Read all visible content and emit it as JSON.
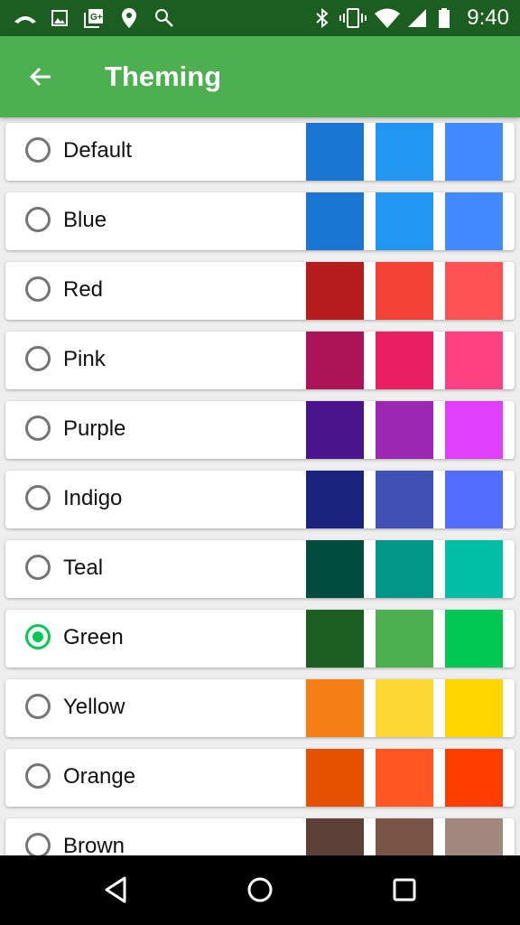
{
  "status_bar": {
    "time": "9:40",
    "left_icons": [
      "missed-call-icon",
      "image-icon",
      "google-plus-icon",
      "location-icon",
      "search-icon"
    ],
    "right_icons": [
      "bluetooth-icon",
      "vibrate-icon",
      "wifi-icon",
      "signal-icon",
      "battery-icon"
    ]
  },
  "app_bar": {
    "title": "Theming",
    "back_icon": "arrow-back-icon"
  },
  "selected": "Green",
  "themes": [
    {
      "name": "Default",
      "selected": false,
      "colors": [
        "#1976d2",
        "#2196f3",
        "#448aff"
      ]
    },
    {
      "name": "Blue",
      "selected": false,
      "colors": [
        "#1976d2",
        "#2196f3",
        "#448aff"
      ]
    },
    {
      "name": "Red",
      "selected": false,
      "colors": [
        "#b71c1c",
        "#f44336",
        "#ff5252"
      ]
    },
    {
      "name": "Pink",
      "selected": false,
      "colors": [
        "#ad1457",
        "#e91e63",
        "#ff4081"
      ]
    },
    {
      "name": "Purple",
      "selected": false,
      "colors": [
        "#4a148c",
        "#9c27b0",
        "#e040fb"
      ]
    },
    {
      "name": "Indigo",
      "selected": false,
      "colors": [
        "#1a237e",
        "#3f51b5",
        "#536dfe"
      ]
    },
    {
      "name": "Teal",
      "selected": false,
      "colors": [
        "#004d40",
        "#009688",
        "#00bfa5"
      ]
    },
    {
      "name": "Green",
      "selected": true,
      "colors": [
        "#1b5e20",
        "#4caf50",
        "#00c853"
      ]
    },
    {
      "name": "Yellow",
      "selected": false,
      "colors": [
        "#f57f17",
        "#fdd835",
        "#ffd600"
      ]
    },
    {
      "name": "Orange",
      "selected": false,
      "colors": [
        "#e65100",
        "#ff5722",
        "#ff3d00"
      ]
    },
    {
      "name": "Brown",
      "selected": false,
      "colors": [
        "#5d4037",
        "#795548",
        "#a1887f"
      ]
    }
  ],
  "nav_bar": [
    "back-icon",
    "home-icon",
    "recents-icon"
  ]
}
